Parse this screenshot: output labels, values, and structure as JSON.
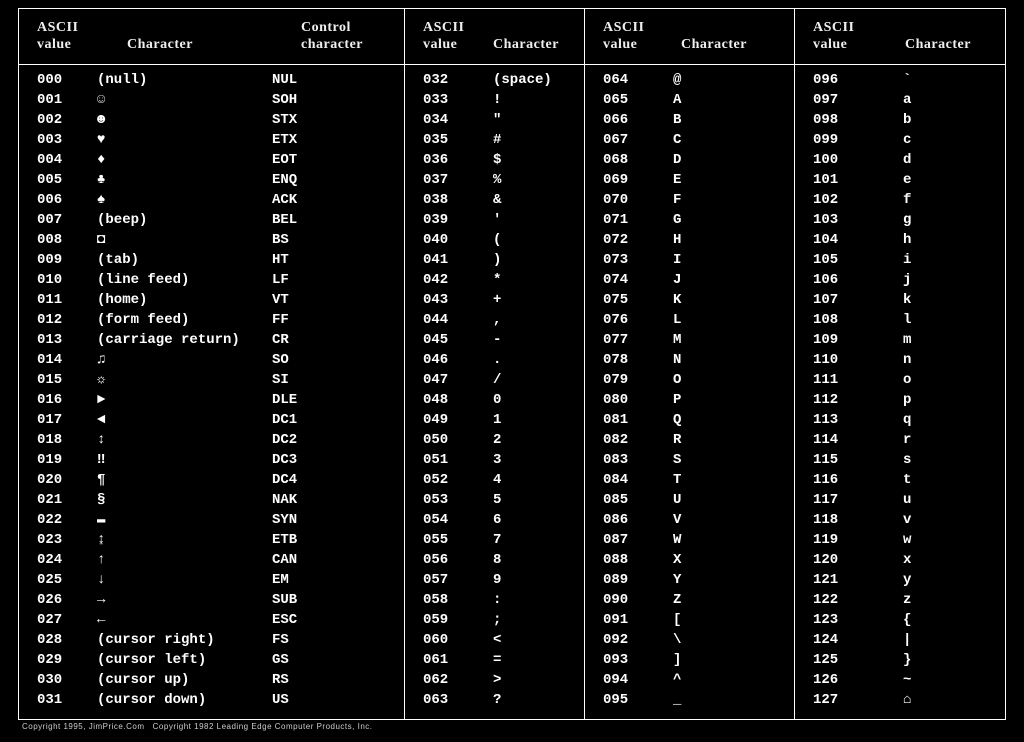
{
  "headers": {
    "ascii_value": "ASCII\nvalue",
    "character": "Character",
    "control_character": "Control\ncharacter"
  },
  "footer": "Copyright 1995, JimPrice.Com   Copyright 1982 Leading Edge Computer Products, Inc.",
  "col0": [
    {
      "v": "000",
      "ch": "(null)",
      "cc": "NUL"
    },
    {
      "v": "001",
      "ch": "☺",
      "cc": "SOH"
    },
    {
      "v": "002",
      "ch": "☻",
      "cc": "STX"
    },
    {
      "v": "003",
      "ch": "♥",
      "cc": "ETX"
    },
    {
      "v": "004",
      "ch": "♦",
      "cc": "EOT"
    },
    {
      "v": "005",
      "ch": "♣",
      "cc": "ENQ"
    },
    {
      "v": "006",
      "ch": "♠",
      "cc": "ACK"
    },
    {
      "v": "007",
      "ch": "(beep)",
      "cc": "BEL"
    },
    {
      "v": "008",
      "ch": "◘",
      "cc": "BS"
    },
    {
      "v": "009",
      "ch": "(tab)",
      "cc": "HT"
    },
    {
      "v": "010",
      "ch": "(line feed)",
      "cc": "LF"
    },
    {
      "v": "011",
      "ch": "(home)",
      "cc": "VT"
    },
    {
      "v": "012",
      "ch": "(form feed)",
      "cc": "FF"
    },
    {
      "v": "013",
      "ch": "(carriage return)",
      "cc": "CR"
    },
    {
      "v": "014",
      "ch": "♫",
      "cc": "SO"
    },
    {
      "v": "015",
      "ch": "☼",
      "cc": "SI"
    },
    {
      "v": "016",
      "ch": "►",
      "cc": "DLE"
    },
    {
      "v": "017",
      "ch": "◄",
      "cc": "DC1"
    },
    {
      "v": "018",
      "ch": "↕",
      "cc": "DC2"
    },
    {
      "v": "019",
      "ch": "‼",
      "cc": "DC3"
    },
    {
      "v": "020",
      "ch": "¶",
      "cc": "DC4"
    },
    {
      "v": "021",
      "ch": "§",
      "cc": "NAK"
    },
    {
      "v": "022",
      "ch": "▬",
      "cc": "SYN"
    },
    {
      "v": "023",
      "ch": "↨",
      "cc": "ETB"
    },
    {
      "v": "024",
      "ch": "↑",
      "cc": "CAN"
    },
    {
      "v": "025",
      "ch": "↓",
      "cc": "EM"
    },
    {
      "v": "026",
      "ch": "→",
      "cc": "SUB"
    },
    {
      "v": "027",
      "ch": "←",
      "cc": "ESC"
    },
    {
      "v": "028",
      "ch": "(cursor right)",
      "cc": "FS"
    },
    {
      "v": "029",
      "ch": "(cursor left)",
      "cc": "GS"
    },
    {
      "v": "030",
      "ch": "(cursor up)",
      "cc": "RS"
    },
    {
      "v": "031",
      "ch": "(cursor down)",
      "cc": "US"
    }
  ],
  "col1": [
    {
      "v": "032",
      "ch": "(space)"
    },
    {
      "v": "033",
      "ch": "!"
    },
    {
      "v": "034",
      "ch": "\""
    },
    {
      "v": "035",
      "ch": "#"
    },
    {
      "v": "036",
      "ch": "$"
    },
    {
      "v": "037",
      "ch": "%"
    },
    {
      "v": "038",
      "ch": "&"
    },
    {
      "v": "039",
      "ch": "'"
    },
    {
      "v": "040",
      "ch": "("
    },
    {
      "v": "041",
      "ch": ")"
    },
    {
      "v": "042",
      "ch": "*"
    },
    {
      "v": "043",
      "ch": "+"
    },
    {
      "v": "044",
      "ch": ","
    },
    {
      "v": "045",
      "ch": "-"
    },
    {
      "v": "046",
      "ch": "."
    },
    {
      "v": "047",
      "ch": "/"
    },
    {
      "v": "048",
      "ch": "0"
    },
    {
      "v": "049",
      "ch": "1"
    },
    {
      "v": "050",
      "ch": "2"
    },
    {
      "v": "051",
      "ch": "3"
    },
    {
      "v": "052",
      "ch": "4"
    },
    {
      "v": "053",
      "ch": "5"
    },
    {
      "v": "054",
      "ch": "6"
    },
    {
      "v": "055",
      "ch": "7"
    },
    {
      "v": "056",
      "ch": "8"
    },
    {
      "v": "057",
      "ch": "9"
    },
    {
      "v": "058",
      "ch": ":"
    },
    {
      "v": "059",
      "ch": ";"
    },
    {
      "v": "060",
      "ch": "<"
    },
    {
      "v": "061",
      "ch": "="
    },
    {
      "v": "062",
      "ch": ">"
    },
    {
      "v": "063",
      "ch": "?"
    }
  ],
  "col2": [
    {
      "v": "064",
      "ch": "@"
    },
    {
      "v": "065",
      "ch": "A"
    },
    {
      "v": "066",
      "ch": "B"
    },
    {
      "v": "067",
      "ch": "C"
    },
    {
      "v": "068",
      "ch": "D"
    },
    {
      "v": "069",
      "ch": "E"
    },
    {
      "v": "070",
      "ch": "F"
    },
    {
      "v": "071",
      "ch": "G"
    },
    {
      "v": "072",
      "ch": "H"
    },
    {
      "v": "073",
      "ch": "I"
    },
    {
      "v": "074",
      "ch": "J"
    },
    {
      "v": "075",
      "ch": "K"
    },
    {
      "v": "076",
      "ch": "L"
    },
    {
      "v": "077",
      "ch": "M"
    },
    {
      "v": "078",
      "ch": "N"
    },
    {
      "v": "079",
      "ch": "O"
    },
    {
      "v": "080",
      "ch": "P"
    },
    {
      "v": "081",
      "ch": "Q"
    },
    {
      "v": "082",
      "ch": "R"
    },
    {
      "v": "083",
      "ch": "S"
    },
    {
      "v": "084",
      "ch": "T"
    },
    {
      "v": "085",
      "ch": "U"
    },
    {
      "v": "086",
      "ch": "V"
    },
    {
      "v": "087",
      "ch": "W"
    },
    {
      "v": "088",
      "ch": "X"
    },
    {
      "v": "089",
      "ch": "Y"
    },
    {
      "v": "090",
      "ch": "Z"
    },
    {
      "v": "091",
      "ch": "["
    },
    {
      "v": "092",
      "ch": "\\"
    },
    {
      "v": "093",
      "ch": "]"
    },
    {
      "v": "094",
      "ch": "^"
    },
    {
      "v": "095",
      "ch": "_"
    }
  ],
  "col3": [
    {
      "v": "096",
      "ch": "`"
    },
    {
      "v": "097",
      "ch": "a"
    },
    {
      "v": "098",
      "ch": "b"
    },
    {
      "v": "099",
      "ch": "c"
    },
    {
      "v": "100",
      "ch": "d"
    },
    {
      "v": "101",
      "ch": "e"
    },
    {
      "v": "102",
      "ch": "f"
    },
    {
      "v": "103",
      "ch": "g"
    },
    {
      "v": "104",
      "ch": "h"
    },
    {
      "v": "105",
      "ch": "i"
    },
    {
      "v": "106",
      "ch": "j"
    },
    {
      "v": "107",
      "ch": "k"
    },
    {
      "v": "108",
      "ch": "l"
    },
    {
      "v": "109",
      "ch": "m"
    },
    {
      "v": "110",
      "ch": "n"
    },
    {
      "v": "111",
      "ch": "o"
    },
    {
      "v": "112",
      "ch": "p"
    },
    {
      "v": "113",
      "ch": "q"
    },
    {
      "v": "114",
      "ch": "r"
    },
    {
      "v": "115",
      "ch": "s"
    },
    {
      "v": "116",
      "ch": "t"
    },
    {
      "v": "117",
      "ch": "u"
    },
    {
      "v": "118",
      "ch": "v"
    },
    {
      "v": "119",
      "ch": "w"
    },
    {
      "v": "120",
      "ch": "x"
    },
    {
      "v": "121",
      "ch": "y"
    },
    {
      "v": "122",
      "ch": "z"
    },
    {
      "v": "123",
      "ch": "{"
    },
    {
      "v": "124",
      "ch": "|"
    },
    {
      "v": "125",
      "ch": "}"
    },
    {
      "v": "126",
      "ch": "~"
    },
    {
      "v": "127",
      "ch": "⌂"
    }
  ]
}
